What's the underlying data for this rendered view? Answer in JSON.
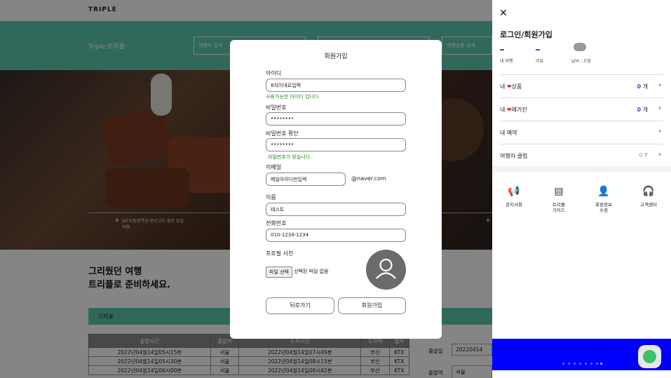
{
  "background": {
    "brand": "TRIPLE",
    "band_title": "Triple 트리플",
    "search_boxes": [
      "여행지 검색",
      "",
      "여행상품 검색"
    ],
    "hero_caption": "[KTX]동문특선·천년고도 경주 당일여행",
    "slogan_line1": "그리웠던 여행",
    "slogan_line2": "트리플로 준비하세요.",
    "timetable_label": "기차표",
    "timetable": {
      "headers": [
        "출발시간",
        "출발역",
        "도착시간",
        "도착역",
        "열차"
      ],
      "rows": [
        [
          "2022년04월14일05시15분",
          "서울",
          "2022년04월14일07시49분",
          "부산",
          "KTX"
        ],
        [
          "2022년04월14일05시30분",
          "서울",
          "2022년04월14일08시15분",
          "부산",
          "KTX"
        ],
        [
          "2022년04월14일06시00분",
          "서울",
          "2022년04월14일08시42분",
          "부산",
          "KTX"
        ]
      ]
    },
    "side_form": {
      "date_label": "출발일",
      "date_value": "20220414",
      "station_label": "출발역",
      "station_value": "서울"
    }
  },
  "modal": {
    "title": "회원가입",
    "id_label": "아이디",
    "id_value": "8자이내로입력",
    "id_ok": "사용가능한 아이디 입니다.",
    "pw_label": "비밀번호",
    "pw_value": "••••••••",
    "pw2_label": "비밀번호 확인",
    "pw2_value": "••••••••",
    "pw_ok": "비밀번호가 맞습니다.",
    "email_label": "이메일",
    "email_value": "메일아이디만입력",
    "email_domain": "@naver.com",
    "name_label": "이름",
    "name_value": "테스트",
    "phone_label": "전화번호",
    "phone_value": "010-1234-1234",
    "photo_label": "프로필 사진",
    "file_button": "파일 선택",
    "file_status": "선택된 파일 없음",
    "back_button": "뒤로가기",
    "submit_button": "회원가입"
  },
  "drawer": {
    "title": "로그인/회원가입",
    "stats": [
      {
        "value": "-",
        "label": "내 여행"
      },
      {
        "value": "-",
        "label": "리뷰"
      }
    ],
    "weather_label": "날씨 : 흐림",
    "rows": [
      {
        "prefix": "내 ",
        "suffix": "상품",
        "value": "0",
        "unit": " 개"
      },
      {
        "prefix": "내 ",
        "suffix": "매거진",
        "value": "0",
        "unit": " 개"
      },
      {
        "prefix": "내 예약",
        "suffix": "",
        "value": "",
        "unit": ""
      },
      {
        "prefix": "여행자 클럽",
        "suffix": "",
        "value": "",
        "unit": "0 P"
      }
    ],
    "quick": [
      {
        "icon": "megaphone-icon",
        "label": "공지사항"
      },
      {
        "icon": "book-icon",
        "label": "트리플\n가이드"
      },
      {
        "icon": "person-icon",
        "label": "회원정보\n수정"
      },
      {
        "icon": "headset-icon",
        "label": "고객센터"
      }
    ],
    "accent": "#2255dd",
    "banner_color": "#0000ff"
  }
}
